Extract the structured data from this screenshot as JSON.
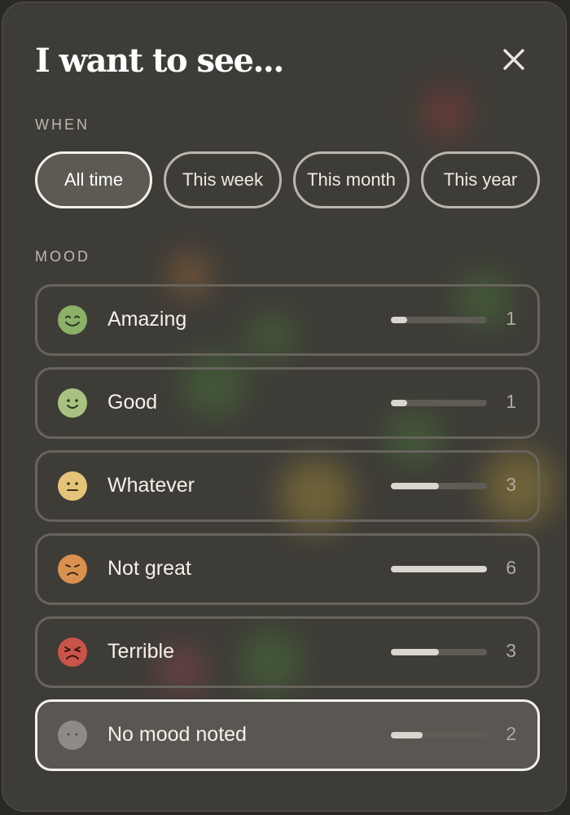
{
  "header": {
    "title": "I want to see..."
  },
  "when": {
    "label": "WHEN",
    "chips": [
      {
        "label": "All time",
        "selected": true
      },
      {
        "label": "This week",
        "selected": false
      },
      {
        "label": "This month",
        "selected": false
      },
      {
        "label": "This year",
        "selected": false
      }
    ]
  },
  "mood": {
    "label": "MOOD",
    "items": [
      {
        "label": "Amazing",
        "count": "1",
        "fraction": 0.167,
        "color": "#8bb068",
        "face": "grin",
        "selected": false
      },
      {
        "label": "Good",
        "count": "1",
        "fraction": 0.167,
        "color": "#a9c282",
        "face": "smile",
        "selected": false
      },
      {
        "label": "Whatever",
        "count": "3",
        "fraction": 0.5,
        "color": "#e5c47a",
        "face": "neutral",
        "selected": false
      },
      {
        "label": "Not great",
        "count": "6",
        "fraction": 1.0,
        "color": "#d99150",
        "face": "frown",
        "selected": false
      },
      {
        "label": "Terrible",
        "count": "3",
        "fraction": 0.5,
        "color": "#c9544a",
        "face": "sad",
        "selected": false
      },
      {
        "label": "No mood noted",
        "count": "2",
        "fraction": 0.333,
        "color": "#8e8b86",
        "face": "blank",
        "selected": true
      }
    ]
  }
}
